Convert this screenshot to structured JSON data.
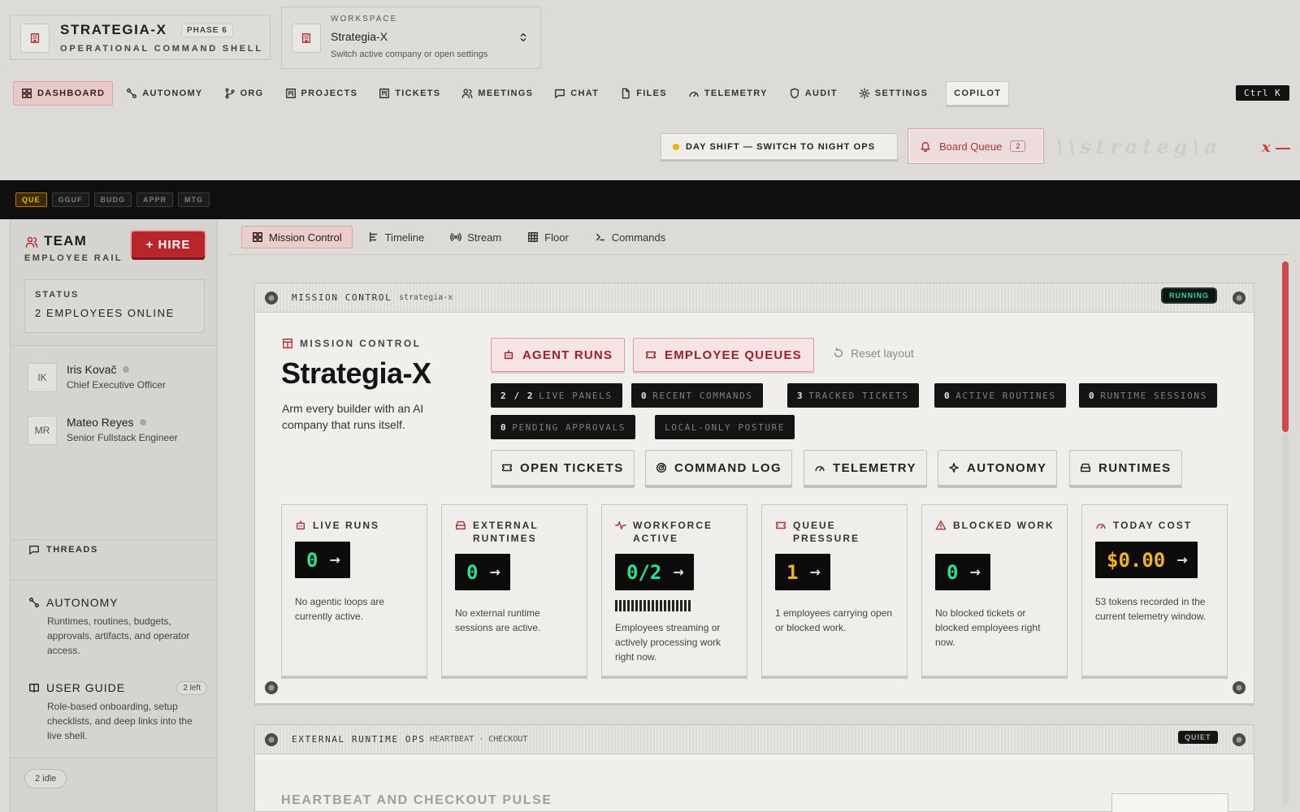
{
  "brand": {
    "name": "STRATEGIA-X",
    "phase": "PHASE 6",
    "subtitle": "OPERATIONAL COMMAND SHELL"
  },
  "workspace": {
    "label": "WORKSPACE",
    "value": "Strategia-X",
    "hint": "Switch active company or open settings"
  },
  "nav": {
    "items": [
      {
        "label": "DASHBOARD",
        "icon": "grid-icon"
      },
      {
        "label": "AUTONOMY",
        "icon": "nodes-icon"
      },
      {
        "label": "ORG",
        "icon": "branch-icon"
      },
      {
        "label": "PROJECTS",
        "icon": "kanban-icon"
      },
      {
        "label": "TICKETS",
        "icon": "kanban-icon"
      },
      {
        "label": "MEETINGS",
        "icon": "users-icon"
      },
      {
        "label": "CHAT",
        "icon": "chat-icon"
      },
      {
        "label": "FILES",
        "icon": "file-icon"
      },
      {
        "label": "TELEMETRY",
        "icon": "gauge-icon"
      },
      {
        "label": "AUDIT",
        "icon": "shield-icon"
      },
      {
        "label": "SETTINGS",
        "icon": "gear-icon"
      }
    ],
    "copilot": "COPILOT",
    "shortcut": "Ctrl K"
  },
  "shift": {
    "label": "DAY SHIFT — SWITCH TO NIGHT OPS",
    "dot_color": "#f0b400"
  },
  "board_queue": {
    "label": "Board Queue",
    "count": "2"
  },
  "watermark": {
    "text": "\\\\strateg\\a",
    "x": "x"
  },
  "strip": {
    "chips": [
      "QUE",
      "GGUF",
      "BUDG",
      "APPR",
      "MTG"
    ]
  },
  "sidebar": {
    "title": "TEAM",
    "subtitle": "EMPLOYEE RAIL",
    "hire": "+ HIRE",
    "status_label": "STATUS",
    "status_value": "2 EMPLOYEES ONLINE",
    "employees": [
      {
        "initials": "IK",
        "name": "Iris Kovač",
        "role": "Chief Executive Officer"
      },
      {
        "initials": "MR",
        "name": "Mateo Reyes",
        "role": "Senior Fullstack Engineer"
      }
    ],
    "threads": "THREADS",
    "autonomy": {
      "title": "AUTONOMY",
      "desc": "Runtimes, routines, budgets, approvals, artifacts, and operator access."
    },
    "guide": {
      "title": "USER GUIDE",
      "badge": "2 left",
      "desc": "Role-based onboarding, setup checklists, and deep links into the live shell."
    },
    "idle": "2 idle"
  },
  "tabs": [
    "Mission Control",
    "Timeline",
    "Stream",
    "Floor",
    "Commands"
  ],
  "mission": {
    "header": "MISSION CONTROL",
    "slug": "strategia-x",
    "state": "RUNNING",
    "label": "MISSION CONTROL",
    "title": "Strategia-X",
    "desc": "Arm every builder with an AI company that runs itself.",
    "primary_buttons": [
      "AGENT RUNS",
      "EMPLOYEE QUEUES"
    ],
    "reset": "Reset layout",
    "stats": [
      {
        "value": "2 / 2",
        "label": "LIVE PANELS"
      },
      {
        "value": "0",
        "label": "RECENT COMMANDS"
      },
      {
        "value": "3",
        "label": "TRACKED TICKETS"
      },
      {
        "value": "0",
        "label": "ACTIVE ROUTINES"
      },
      {
        "value": "0",
        "label": "RUNTIME SESSIONS"
      },
      {
        "value": "0",
        "label": "PENDING APPROVALS"
      },
      {
        "value": "",
        "label": "LOCAL-ONLY POSTURE"
      }
    ],
    "actions": [
      "OPEN TICKETS",
      "COMMAND LOG",
      "TELEMETRY",
      "AUTONOMY",
      "RUNTIMES"
    ],
    "cards": [
      {
        "title": "LIVE RUNS",
        "value": "0",
        "desc": "No agentic loops are currently active."
      },
      {
        "title": "EXTERNAL RUNTIMES",
        "value": "0",
        "desc": "No external runtime sessions are active."
      },
      {
        "title": "WORKFORCE ACTIVE",
        "value": "0/2",
        "desc": "Employees streaming or actively processing work right now."
      },
      {
        "title": "QUEUE PRESSURE",
        "value": "1",
        "desc": "1 employees carrying open or blocked work."
      },
      {
        "title": "BLOCKED WORK",
        "value": "0",
        "desc": "No blocked tickets or blocked employees right now."
      },
      {
        "title": "TODAY COST",
        "value": "$0.00",
        "desc": "53 tokens recorded in the current telemetry window."
      }
    ]
  },
  "runtime_ops": {
    "header": "EXTERNAL RUNTIME OPS",
    "sub": "HEARTBEAT · CHECKOUT",
    "state": "QUIET",
    "title": "HEARTBEAT AND CHECKOUT PULSE"
  },
  "colors": {
    "accent": "#b2323a",
    "lcd_green": "#2fe08a",
    "lcd_amber": "#f3b31b",
    "running": "#2fd49a"
  }
}
